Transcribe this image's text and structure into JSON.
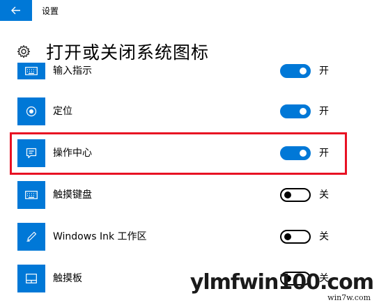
{
  "window": {
    "title": "设置"
  },
  "header": {
    "title": "打开或关闭系统图标"
  },
  "items": [
    {
      "label": "输入指示",
      "state": "开",
      "on": true,
      "icon": "keyboard-icon"
    },
    {
      "label": "定位",
      "state": "开",
      "on": true,
      "icon": "location-icon"
    },
    {
      "label": "操作中心",
      "state": "开",
      "on": true,
      "icon": "action-center-icon"
    },
    {
      "label": "触摸键盘",
      "state": "关",
      "on": false,
      "icon": "keyboard-icon"
    },
    {
      "label": "Windows Ink 工作区",
      "state": "关",
      "on": false,
      "icon": "pen-icon"
    },
    {
      "label": "触摸板",
      "state": "关",
      "on": false,
      "icon": "touchpad-icon"
    }
  ],
  "watermark": {
    "line1": "ylmfwin100.com",
    "line2": "win7w.com"
  },
  "colors": {
    "accent": "#0078d7",
    "highlight": "#e81123"
  }
}
